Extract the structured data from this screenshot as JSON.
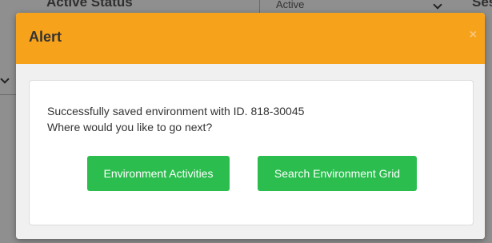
{
  "background": {
    "field_label": "Active Status",
    "select_value": "Active",
    "right_label": "Ses"
  },
  "modal": {
    "title": "Alert",
    "close_glyph": "×",
    "message_line1": "Successfully saved environment with ID. 818-30045",
    "message_line2": "Where would you like to go next?",
    "buttons": {
      "activities_label": "Environment Activities",
      "search_label": "Search Environment Grid"
    }
  },
  "colors": {
    "header": "#f7a21b",
    "button": "#2bbd4e",
    "overlay": "#8f8f8f"
  }
}
